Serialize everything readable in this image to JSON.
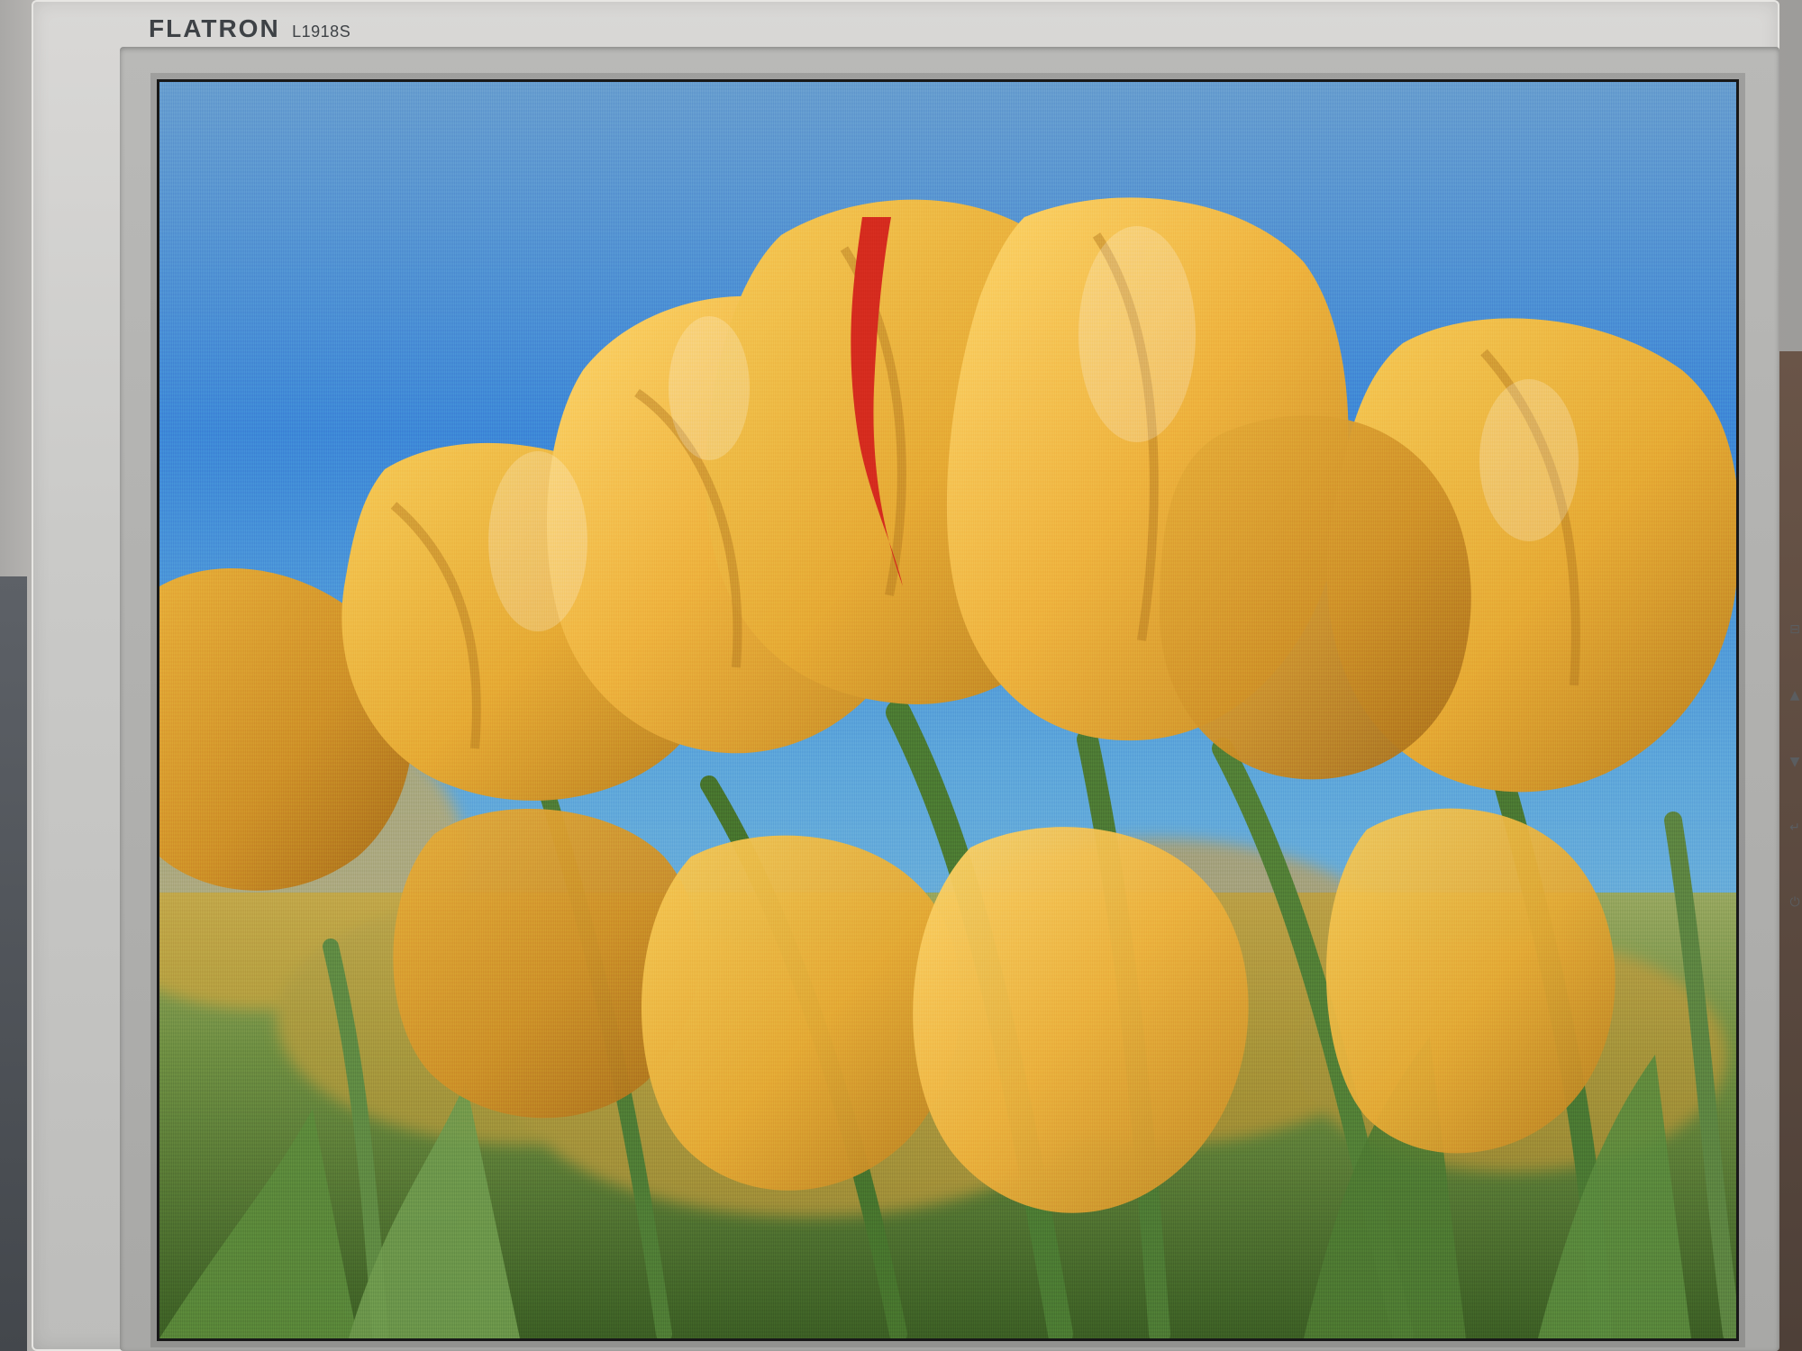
{
  "monitor": {
    "brand": "FLATRON",
    "model": "L1918S"
  },
  "screen": {
    "sky_colors": [
      "#5f98cf",
      "#3f8bd6",
      "#7fb1cf"
    ],
    "tulip_colors": [
      "#f0b33f",
      "#e8a42f",
      "#ffd15c",
      "#c58a23"
    ],
    "stem_colors": [
      "#517b3a",
      "#3f6729",
      "#78995a"
    ],
    "accent_red": "#d52b1e"
  },
  "buttons": {
    "menu_icon": "menu-icon",
    "up_icon": "up-arrow-icon",
    "down_icon": "down-arrow-icon",
    "enter_icon": "enter-icon",
    "power_icon": "power-icon"
  }
}
